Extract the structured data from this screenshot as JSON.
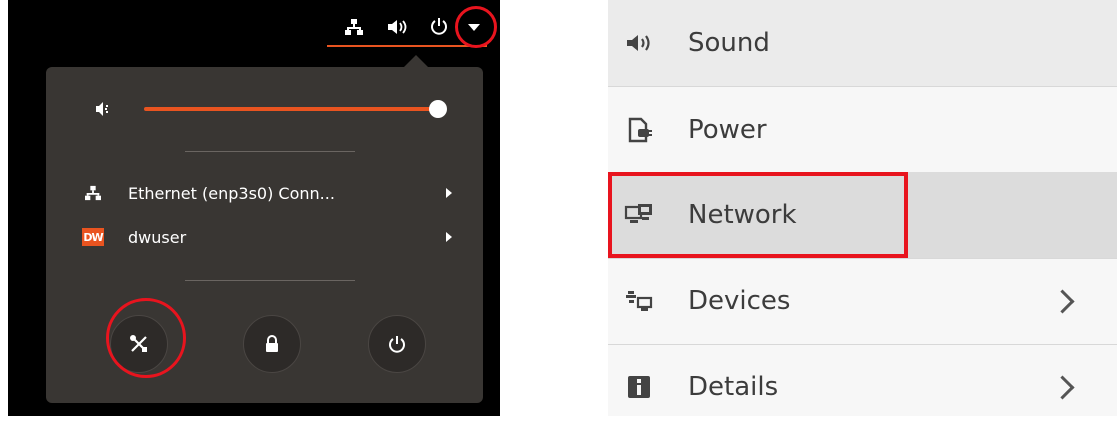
{
  "colors": {
    "accent": "#e95420",
    "highlight": "#e8141e",
    "menu_bg": "#393633",
    "settings_selected": "#dcdcdc"
  },
  "topbar": {
    "icons": [
      "network-icon",
      "volume-icon",
      "power-icon",
      "dropdown-arrow-icon"
    ]
  },
  "system_menu": {
    "volume": {
      "icon": "volume-low-icon",
      "level": 1.0
    },
    "items": [
      {
        "icon": "network-icon",
        "label": "Ethernet (enp3s0) Conn...",
        "has_submenu": true
      },
      {
        "icon": "dw-logo",
        "logo_text": "DW",
        "label": "dwuser",
        "has_submenu": true
      }
    ],
    "buttons": [
      {
        "icon": "settings-tools-icon",
        "name": "settings"
      },
      {
        "icon": "lock-icon",
        "name": "lock"
      },
      {
        "icon": "power-icon",
        "name": "power-off"
      }
    ]
  },
  "settings_sidebar": {
    "items": [
      {
        "icon": "sound-icon",
        "label": "Sound",
        "has_chevron": false,
        "selected": false
      },
      {
        "icon": "power-plug-icon",
        "label": "Power",
        "has_chevron": false,
        "selected": false
      },
      {
        "icon": "network-icon",
        "label": "Network",
        "has_chevron": false,
        "selected": true
      },
      {
        "icon": "devices-icon",
        "label": "Devices",
        "has_chevron": true,
        "selected": false
      },
      {
        "icon": "info-icon",
        "label": "Details",
        "has_chevron": true,
        "selected": false
      }
    ]
  }
}
